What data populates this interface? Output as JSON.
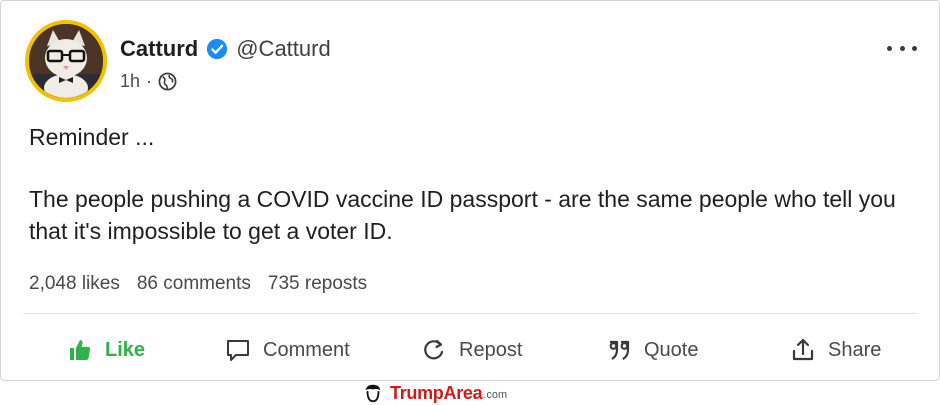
{
  "post": {
    "author": {
      "name": "Catturd",
      "handle": "@Catturd",
      "verified": true
    },
    "time": "1h",
    "separator": "·",
    "visibility_icon": "globe-icon",
    "more_icon": "more-horizontal-icon",
    "text_line1": "Reminder ...",
    "text_line2": "The people pushing a COVID vaccine ID passport - are the same people who tell you that it's impossible to get a voter ID."
  },
  "stats": {
    "likes": "2,048 likes",
    "comments": "86 comments",
    "reposts": "735 reposts"
  },
  "actions": {
    "like": "Like",
    "comment": "Comment",
    "repost": "Repost",
    "quote": "Quote",
    "share": "Share"
  },
  "watermark": {
    "name": "TrumpArea",
    "domain": ".com"
  },
  "colors": {
    "like_green": "#2db34a",
    "verified_blue": "#1d8cf0",
    "avatar_ring": "#f2c200",
    "watermark_red": "#d21a1a"
  }
}
